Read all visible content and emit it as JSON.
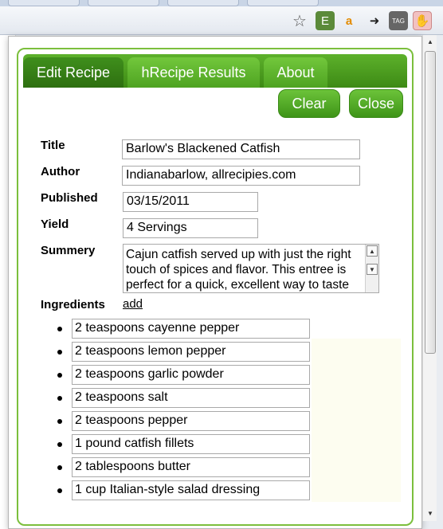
{
  "browser": {
    "icons": [
      "star-icon",
      "evernote-icon",
      "amazon-icon",
      "arrow-phone-icon",
      "tag-icon",
      "recipe-extension-icon"
    ],
    "tag_icon_label": "TAG"
  },
  "popup": {
    "tabs": [
      {
        "label": "Edit Recipe",
        "active": true
      },
      {
        "label": "hRecipe Results",
        "active": false
      },
      {
        "label": "About",
        "active": false
      }
    ],
    "buttons": {
      "clear": "Clear",
      "close": "Close"
    },
    "fields": {
      "title_label": "Title",
      "title_value": "Barlow's Blackened Catfish",
      "author_label": "Author",
      "author_value": "Indianabarlow, allrecipies.com",
      "published_label": "Published",
      "published_value": "03/15/2011",
      "yield_label": "Yield",
      "yield_value": "4 Servings",
      "summary_label": "Summery",
      "summary_value": "Cajun catfish served up with just the right touch of spices and flavor. This entree is perfect for a quick, excellent way to taste"
    },
    "ingredients_label": "Ingredients",
    "add_link": "add",
    "ingredients": [
      "2 teaspoons cayenne pepper",
      "2 teaspoons lemon pepper",
      "2 teaspoons garlic powder",
      "2 teaspoons salt",
      "2 teaspoons pepper",
      "1 pound catfish fillets",
      "2 tablespoons butter",
      "1 cup Italian-style salad dressing"
    ],
    "colors": {
      "accent": "#4ea321",
      "dark_green": "#2e6f10",
      "border_green": "#7bbf3c"
    }
  }
}
